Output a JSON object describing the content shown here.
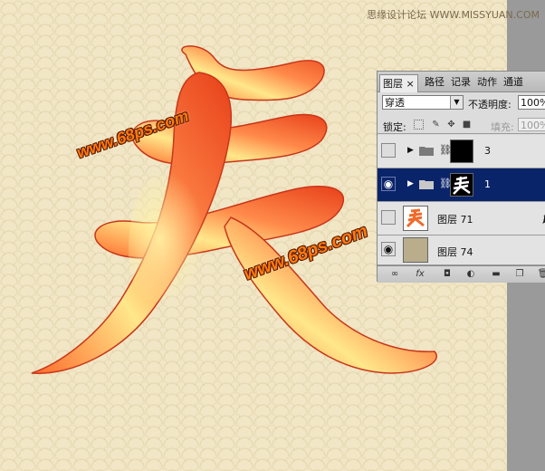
{
  "watermark": {
    "site_text": "思缘设计论坛 WWW.MISSYUAN.COM",
    "brand_text": "www.68ps.com"
  },
  "artwork": {
    "glyph": "夫"
  },
  "layers_panel": {
    "tabs": [
      {
        "label": "图层",
        "close": "×",
        "active": true
      },
      {
        "label": "路径",
        "active": false
      },
      {
        "label": "记录",
        "active": false
      },
      {
        "label": "动作",
        "active": false
      },
      {
        "label": "通道",
        "active": false
      }
    ],
    "blend_mode": "穿透",
    "opacity_label": "不透明度:",
    "opacity_value": "100%",
    "lock_label": "锁定:",
    "fill_label": "填充:",
    "fill_value": "100%",
    "layers": [
      {
        "name": "3",
        "visible": false,
        "type": "group",
        "selected": false
      },
      {
        "name": "1",
        "visible": true,
        "type": "group",
        "selected": true
      },
      {
        "name": "图层 71",
        "visible": false,
        "type": "layer",
        "fx": "fx",
        "selected": false
      },
      {
        "name": "图层 74",
        "visible": true,
        "type": "layer",
        "selected": false
      }
    ],
    "bottom_icons": [
      "link-icon",
      "fx-icon",
      "mask-icon",
      "adjustment-icon",
      "new-group-icon",
      "new-layer-icon",
      "trash-icon"
    ]
  },
  "colors": {
    "canvas_bg": "#f1e6c5",
    "selection": "#0a246a",
    "glyph_orange": "#f0501e",
    "glyph_yellow": "#ffe98a"
  }
}
